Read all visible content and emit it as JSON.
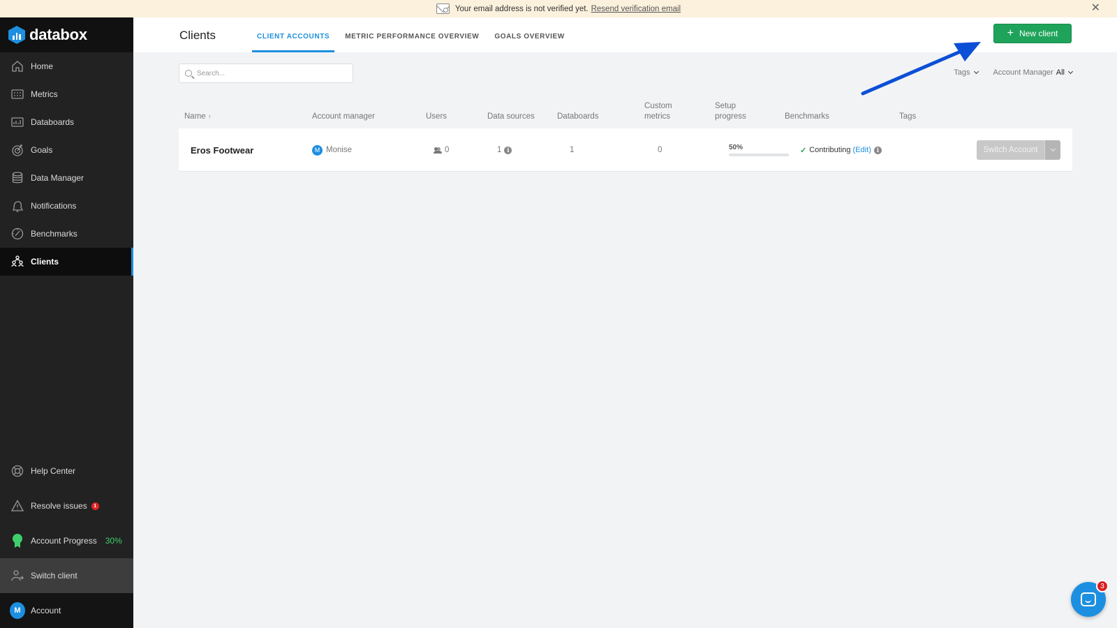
{
  "banner": {
    "message": "Your email address is not verified yet.",
    "link": "Resend verification email"
  },
  "sidebar": {
    "brand": "databox",
    "items": [
      {
        "label": "Home",
        "icon": "home-icon"
      },
      {
        "label": "Metrics",
        "icon": "metrics-icon"
      },
      {
        "label": "Databoards",
        "icon": "databoards-icon"
      },
      {
        "label": "Goals",
        "icon": "goals-icon"
      },
      {
        "label": "Data Manager",
        "icon": "data-manager-icon"
      },
      {
        "label": "Notifications",
        "icon": "bell-icon"
      },
      {
        "label": "Benchmarks",
        "icon": "benchmarks-icon"
      },
      {
        "label": "Clients",
        "icon": "clients-icon",
        "active": true
      }
    ],
    "bottom": {
      "help": "Help Center",
      "resolve": "Resolve issues",
      "resolve_count": "1",
      "progress": "Account Progress",
      "progress_pct": "30%",
      "switch": "Switch client",
      "account": "Account",
      "account_initial": "M"
    }
  },
  "header": {
    "title": "Clients",
    "tabs": [
      "CLIENT ACCOUNTS",
      "METRIC PERFORMANCE OVERVIEW",
      "GOALS OVERVIEW"
    ],
    "new_button": "New client"
  },
  "toolbar": {
    "search_placeholder": "Search...",
    "tags": "Tags",
    "account_manager": "Account Manager",
    "account_manager_value": "All"
  },
  "table": {
    "columns": {
      "name": "Name",
      "name_sort": "↑",
      "manager": "Account manager",
      "users": "Users",
      "data_sources": "Data sources",
      "databoards": "Databoards",
      "custom_metrics_1": "Custom",
      "custom_metrics_2": "metrics",
      "setup_1": "Setup",
      "setup_2": "progress",
      "benchmarks": "Benchmarks",
      "tags": "Tags"
    },
    "rows": [
      {
        "name": "Eros Footwear",
        "manager": "Monise",
        "manager_initial": "M",
        "users": "0",
        "data_sources": "1",
        "databoards": "1",
        "custom_metrics": "0",
        "setup_progress": "50%",
        "setup_progress_value": 0.5,
        "benchmark_status": "Contributing",
        "benchmark_edit": "Edit",
        "switch_label": "Switch Account"
      }
    ]
  },
  "chat": {
    "count": "3"
  },
  "colors": {
    "accent": "#1d8fe0",
    "green": "#1fa35b",
    "sidebar": "#222222",
    "arrow": "#0b4fd6"
  }
}
